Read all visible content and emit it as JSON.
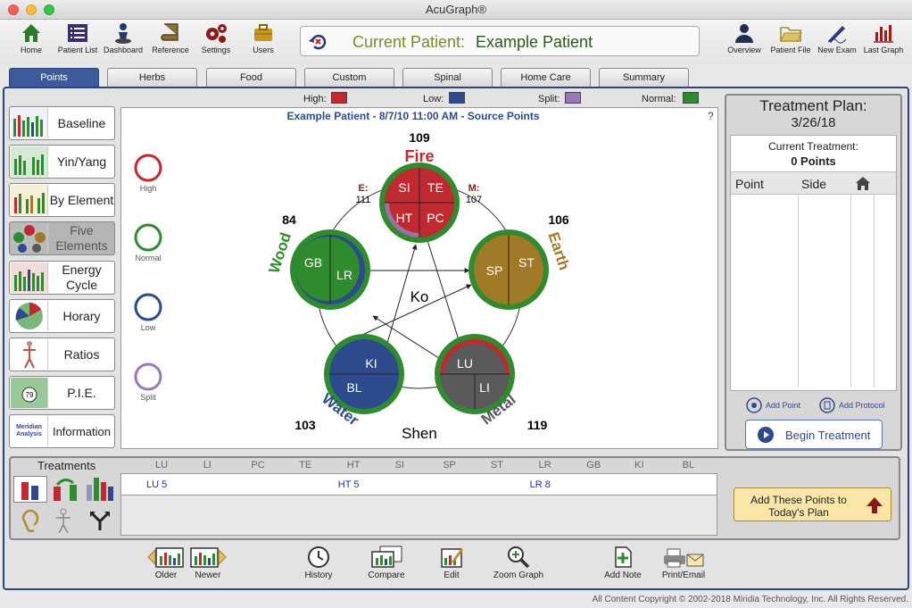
{
  "window": {
    "title": "AcuGraph®"
  },
  "toolbar": {
    "home": "Home",
    "patient_list": "Patient List",
    "dashboard": "Dashboard",
    "reference": "Reference",
    "settings": "Settings",
    "users": "Users",
    "overview": "Overview",
    "patient_file": "Patient File",
    "new_exam": "New Exam",
    "last_graph": "Last Graph"
  },
  "patient": {
    "label": "Current Patient:",
    "name": "Example Patient"
  },
  "tabs": [
    "Points",
    "Herbs",
    "Food",
    "Custom",
    "Spinal",
    "Home Care",
    "Summary"
  ],
  "sidebar": [
    "Baseline",
    "Yin/Yang",
    "By Element",
    "Five Elements",
    "Energy Cycle",
    "Horary",
    "Ratios",
    "P.I.E.",
    "Information"
  ],
  "sidebar_thumbs": {
    "pie_number": "79",
    "info_thumb": "Meridian Analysis"
  },
  "legend": {
    "high": "High:",
    "low": "Low:",
    "split": "Split:",
    "normal": "Normal:"
  },
  "colors": {
    "high": "#c0292f",
    "low": "#2d4a8c",
    "split": "#9a78b8",
    "normal": "#2e8b2e",
    "earth": "#a07a26",
    "metal": "#5a5a5a",
    "accent": "#3d5b9a"
  },
  "chart": {
    "header": "Example Patient - 8/7/10 11:00 AM - Source Points",
    "help": "?",
    "circle_legend": [
      "High",
      "Normal",
      "Low",
      "Split"
    ],
    "center": "Ko",
    "bottom": "Shen",
    "elements": {
      "fire": {
        "name": "Fire",
        "value": "109",
        "points": [
          "SI",
          "TE",
          "HT",
          "PC"
        ]
      },
      "earth": {
        "name": "Earth",
        "value": "106",
        "points": [
          "SP",
          "ST"
        ]
      },
      "metal": {
        "name": "Metal",
        "value": "119",
        "points": [
          "LU",
          "LI"
        ]
      },
      "water": {
        "name": "Water",
        "value": "103",
        "points": [
          "KI",
          "BL"
        ]
      },
      "wood": {
        "name": "Wood",
        "value": "84",
        "points": [
          "GB",
          "LR"
        ]
      }
    },
    "e_label": "E:",
    "e_value": "111",
    "m_label": "M:",
    "m_value": "107"
  },
  "treatment_plan": {
    "title": "Treatment Plan:",
    "date": "3/26/18",
    "current_label": "Current Treatment:",
    "count": "0 Points",
    "columns": [
      "Point",
      "Side"
    ],
    "add_point": "Add Point",
    "add_protocol": "Add Protocol",
    "begin": "Begin Treatment"
  },
  "treatments": {
    "title": "Treatments",
    "meridians": [
      "LU",
      "LI",
      "PC",
      "TE",
      "HT",
      "SI",
      "SP",
      "ST",
      "LR",
      "GB",
      "KI",
      "BL"
    ],
    "selected": [
      {
        "label": "LU 5",
        "col": 0
      },
      {
        "label": "HT 5",
        "col": 4
      },
      {
        "label": "LR 8",
        "col": 8
      }
    ],
    "add_button": "Add These Points to Today's Plan"
  },
  "bottom": {
    "older": "Older",
    "newer": "Newer",
    "history": "History",
    "compare": "Compare",
    "edit": "Edit",
    "zoom": "Zoom Graph",
    "add_note": "Add Note",
    "print": "Print/Email"
  },
  "copyright": "All Content Copyright © 2002-2018 Miridia Technology, Inc.  All Rights Reserved."
}
